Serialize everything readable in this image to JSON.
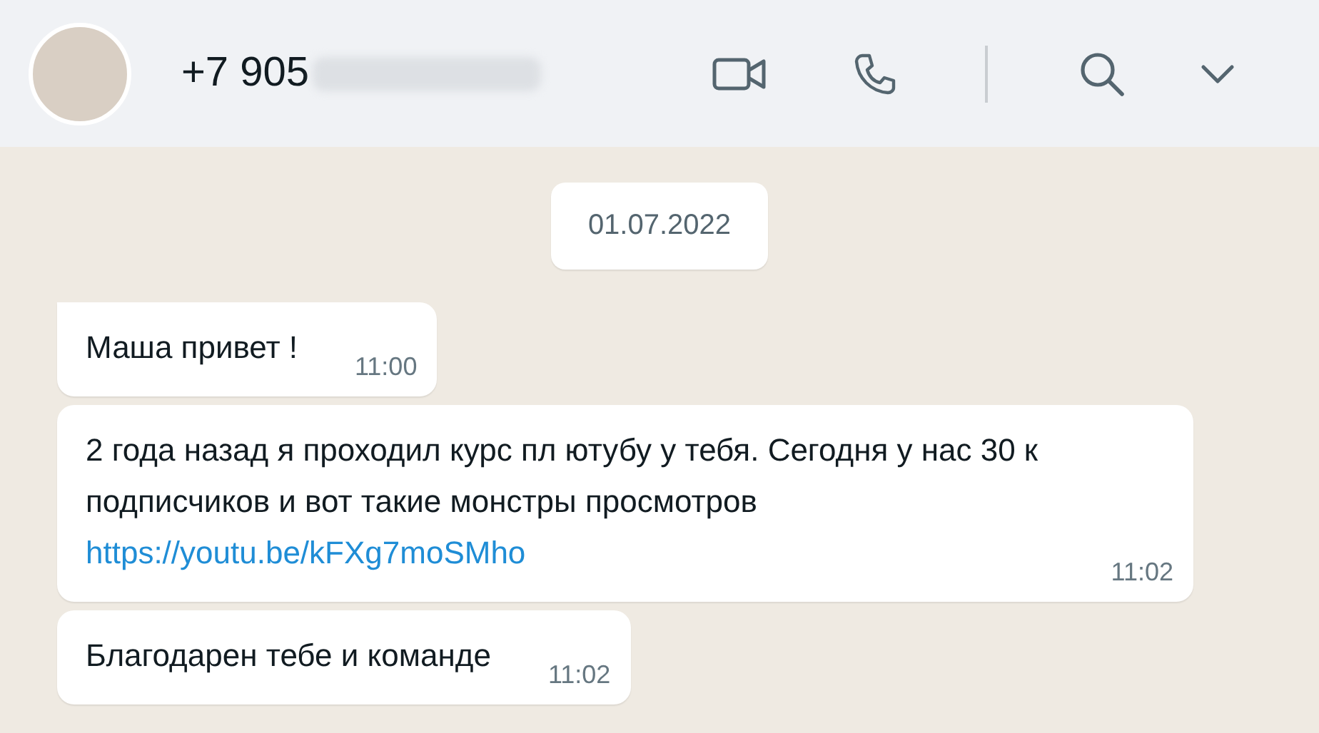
{
  "header": {
    "contact": "+7 905"
  },
  "date": "01.07.2022",
  "messages": [
    {
      "text": "Маша привет !",
      "time": "11:00",
      "tail": true
    },
    {
      "text": "2 года назад я проходил курс пл ютубу у тебя. Сегодня у нас 30 к подписчиков и вот такие монстры просмотров",
      "link": "https://youtu.be/kFXg7moSMho",
      "time": "11:02",
      "tail": false
    },
    {
      "text": "Благодарен тебе и команде",
      "time": "11:02",
      "tail": false
    }
  ]
}
